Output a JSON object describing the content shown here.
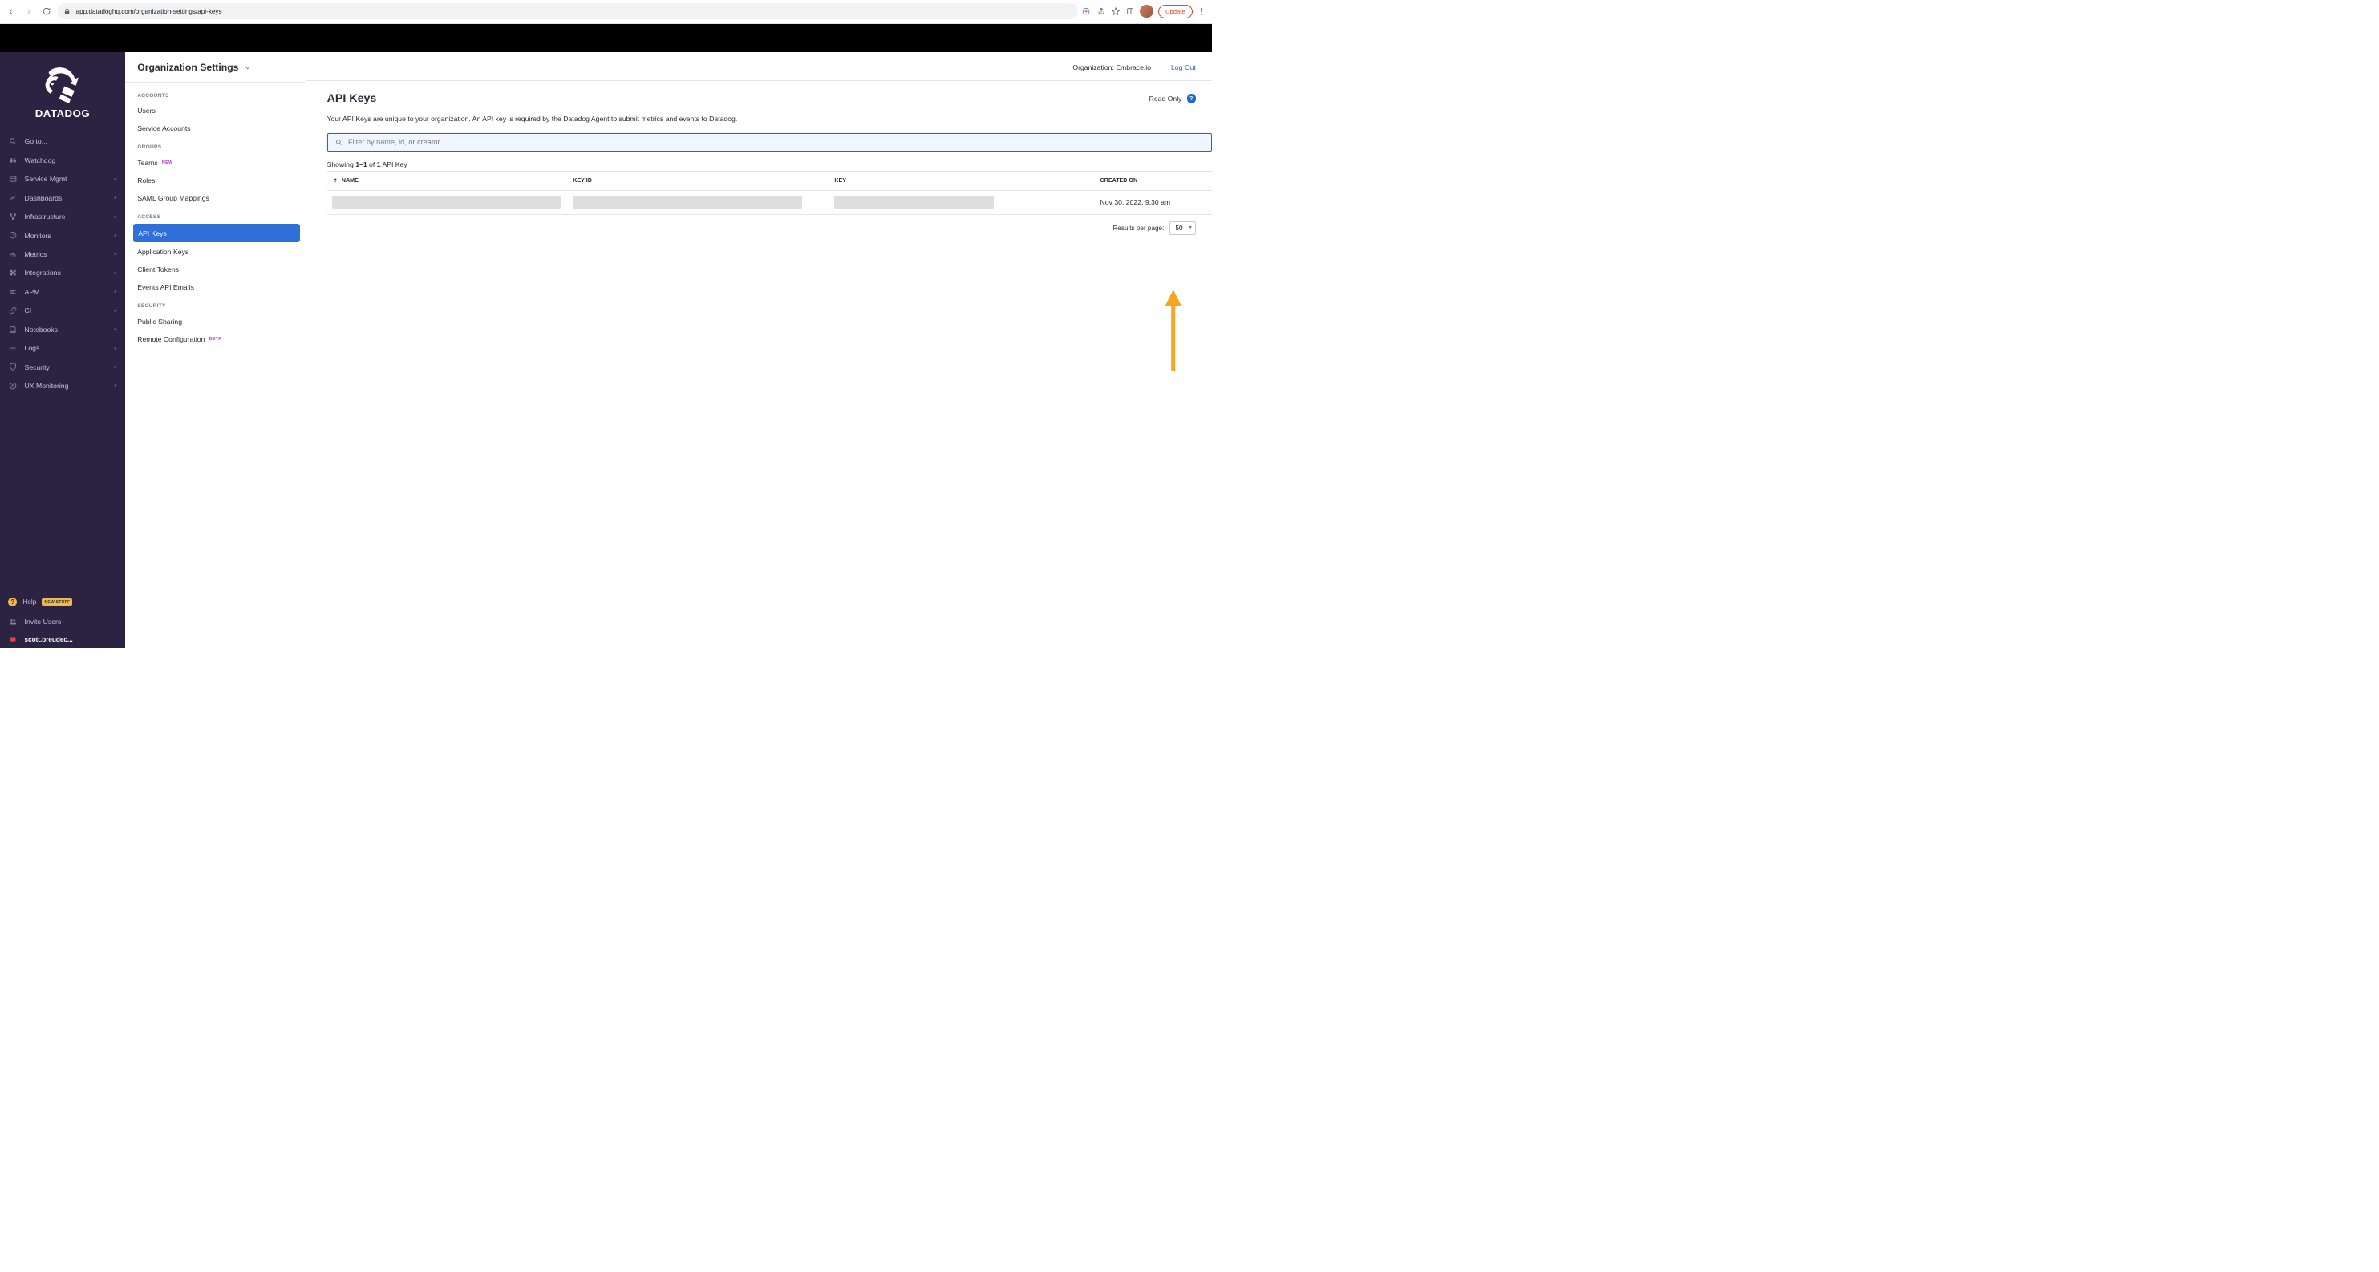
{
  "browser": {
    "url": "app.datadoghq.com/organization-settings/api-keys",
    "update_label": "Update"
  },
  "brand": {
    "name": "DATADOG"
  },
  "vnav": {
    "items": [
      {
        "label": "Go to...",
        "icon": "search"
      },
      {
        "label": "Watchdog",
        "icon": "binoculars"
      },
      {
        "label": "Service Mgmt",
        "icon": "panel",
        "sub": true
      },
      {
        "label": "Dashboards",
        "icon": "chart",
        "sub": true
      },
      {
        "label": "Infrastructure",
        "icon": "nodes",
        "sub": true
      },
      {
        "label": "Monitors",
        "icon": "gauge",
        "sub": true
      },
      {
        "label": "Metrics",
        "icon": "dial",
        "sub": true
      },
      {
        "label": "Integrations",
        "icon": "puzzle",
        "sub": true
      },
      {
        "label": "APM",
        "icon": "bars",
        "sub": true
      },
      {
        "label": "CI",
        "icon": "link",
        "sub": true
      },
      {
        "label": "Notebooks",
        "icon": "book",
        "sub": true
      },
      {
        "label": "Logs",
        "icon": "logs",
        "sub": true
      },
      {
        "label": "Security",
        "icon": "shield",
        "sub": true
      },
      {
        "label": "UX Monitoring",
        "icon": "ux",
        "sub": true
      }
    ],
    "help_label": "Help",
    "help_badge": "NEW STUFF",
    "invite_label": "Invite Users",
    "user_label": "scott.breudec..."
  },
  "settings_sidebar": {
    "title": "Organization Settings",
    "groups": [
      {
        "title": "ACCOUNTS",
        "items": [
          {
            "label": "Users"
          },
          {
            "label": "Service Accounts"
          }
        ]
      },
      {
        "title": "GROUPS",
        "items": [
          {
            "label": "Teams",
            "badge": "NEW",
            "badge_class": "new"
          },
          {
            "label": "Roles"
          },
          {
            "label": "SAML Group Mappings"
          }
        ]
      },
      {
        "title": "ACCESS",
        "items": [
          {
            "label": "API Keys",
            "active": true
          },
          {
            "label": "Application Keys"
          },
          {
            "label": "Client Tokens"
          },
          {
            "label": "Events API Emails"
          }
        ]
      },
      {
        "title": "SECURITY",
        "items": [
          {
            "label": "Public Sharing"
          },
          {
            "label": "Remote Configuration",
            "badge": "BETA",
            "badge_class": "beta"
          }
        ]
      }
    ]
  },
  "header": {
    "org_prefix": "Organization: ",
    "org_name": "Embrace.io",
    "logout": "Log Out"
  },
  "page": {
    "title": "API Keys",
    "readonly": "Read Only",
    "description": "Your API Keys are unique to your organization. An API key is required by the Datadog Agent to submit metrics and events to Datadog.",
    "search_placeholder": "Filter by name, id, or creator",
    "showing_prefix": "Showing ",
    "showing_range": "1–1",
    "showing_of": " of ",
    "showing_total": "1",
    "showing_suffix": " API Key",
    "columns": {
      "name": "NAME",
      "keyid": "KEY ID",
      "key": "KEY",
      "created": "CREATED ON"
    },
    "rows": [
      {
        "created_on": "Nov 30, 2022, 9:30 am"
      }
    ],
    "results_label": "Results per page:",
    "results_per_page": "50"
  }
}
